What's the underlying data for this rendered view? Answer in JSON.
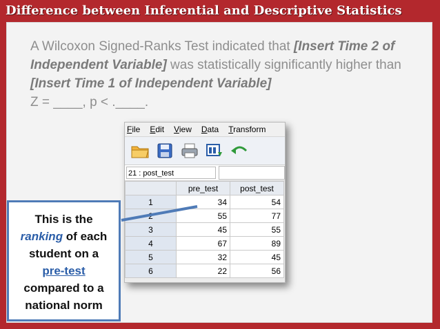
{
  "slide": {
    "title": "Difference between Inferential and Descriptive Statistics",
    "para_1": "A Wilcoxon Signed-Ranks Test indicated that ",
    "para_2": "[Insert Time 2 of Independent Variable]",
    "para_3": " was statistically significantly higher than ",
    "para_4": "[Insert Time 1 of Independent Variable]",
    "para_5": "Z = ____, p < .____."
  },
  "spss": {
    "menu": [
      "File",
      "Edit",
      "View",
      "Data",
      "Transform"
    ],
    "toolbar_icons": [
      "open-folder-icon",
      "save-icon",
      "print-icon",
      "recall-dialog-icon",
      "undo-icon"
    ],
    "cell_ref": "21 : post_test",
    "columns": [
      "pre_test",
      "post_test"
    ],
    "rows": [
      {
        "n": "1",
        "pre": "34",
        "post": "54"
      },
      {
        "n": "2",
        "pre": "55",
        "post": "77"
      },
      {
        "n": "3",
        "pre": "45",
        "post": "55"
      },
      {
        "n": "4",
        "pre": "67",
        "post": "89"
      },
      {
        "n": "5",
        "pre": "32",
        "post": "45"
      },
      {
        "n": "6",
        "pre": "22",
        "post": "56"
      }
    ]
  },
  "note": {
    "line1": "This is the",
    "ranking": "ranking",
    "line2": " of each",
    "line3": "student on a",
    "pretest": "pre-test",
    "line4": "compared to a",
    "line5": "national norm"
  },
  "colors": {
    "header": "#b3282d",
    "accent": "#4f7bb7"
  }
}
